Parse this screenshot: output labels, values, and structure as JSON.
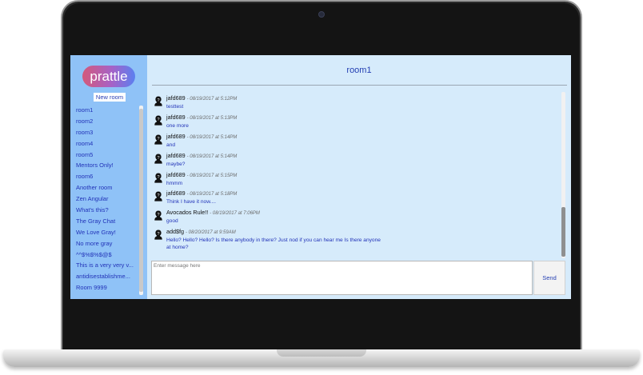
{
  "app": {
    "logo_text": "prattle",
    "new_room_label": "New room"
  },
  "sidebar": {
    "rooms": [
      "room1",
      "room2",
      "room3",
      "room4",
      "room5",
      "Mentors Only!",
      "room6",
      "Another room",
      "Zen Angular",
      "What's this?",
      "The Gray Chat",
      "We Love Gray!",
      "No more gray",
      "^^$%$%$@$",
      "This is a very very v...",
      "antidisestablishme...",
      "Room 9999"
    ]
  },
  "room": {
    "title": "room1"
  },
  "messages": [
    {
      "user": "jafd689",
      "time": "- 08/19/2017 at 5:12PM",
      "text": "testtest"
    },
    {
      "user": "jafd689",
      "time": "- 08/19/2017 at 5:13PM",
      "text": "one more"
    },
    {
      "user": "jafd689",
      "time": "- 08/19/2017 at 5:14PM",
      "text": "and"
    },
    {
      "user": "jafd689",
      "time": "- 08/19/2017 at 5:14PM",
      "text": "maybe?"
    },
    {
      "user": "jafd689",
      "time": "- 08/19/2017 at 5:15PM",
      "text": "hmmm"
    },
    {
      "user": "jafd689",
      "time": "- 08/19/2017 at 5:18PM",
      "text": "Think I have it now...."
    },
    {
      "user": "Avocados Rule!!",
      "time": "- 08/19/2017 at 7:06PM",
      "text": "good"
    },
    {
      "user": "add$fg",
      "time": "- 08/20/2017 at 9:59AM",
      "text": "Hello? Hello? Hello? Is there anybody in there? Just nod if you can hear me Is there anyone at home?"
    }
  ],
  "composer": {
    "placeholder": "Enter message here",
    "send_label": "Send"
  },
  "icons": {
    "avatar": "user-silhouette-icon"
  },
  "colors": {
    "sidebar_bg": "#8fc2f7",
    "main_bg": "#d6ebfb",
    "link_blue": "#2233b8"
  }
}
